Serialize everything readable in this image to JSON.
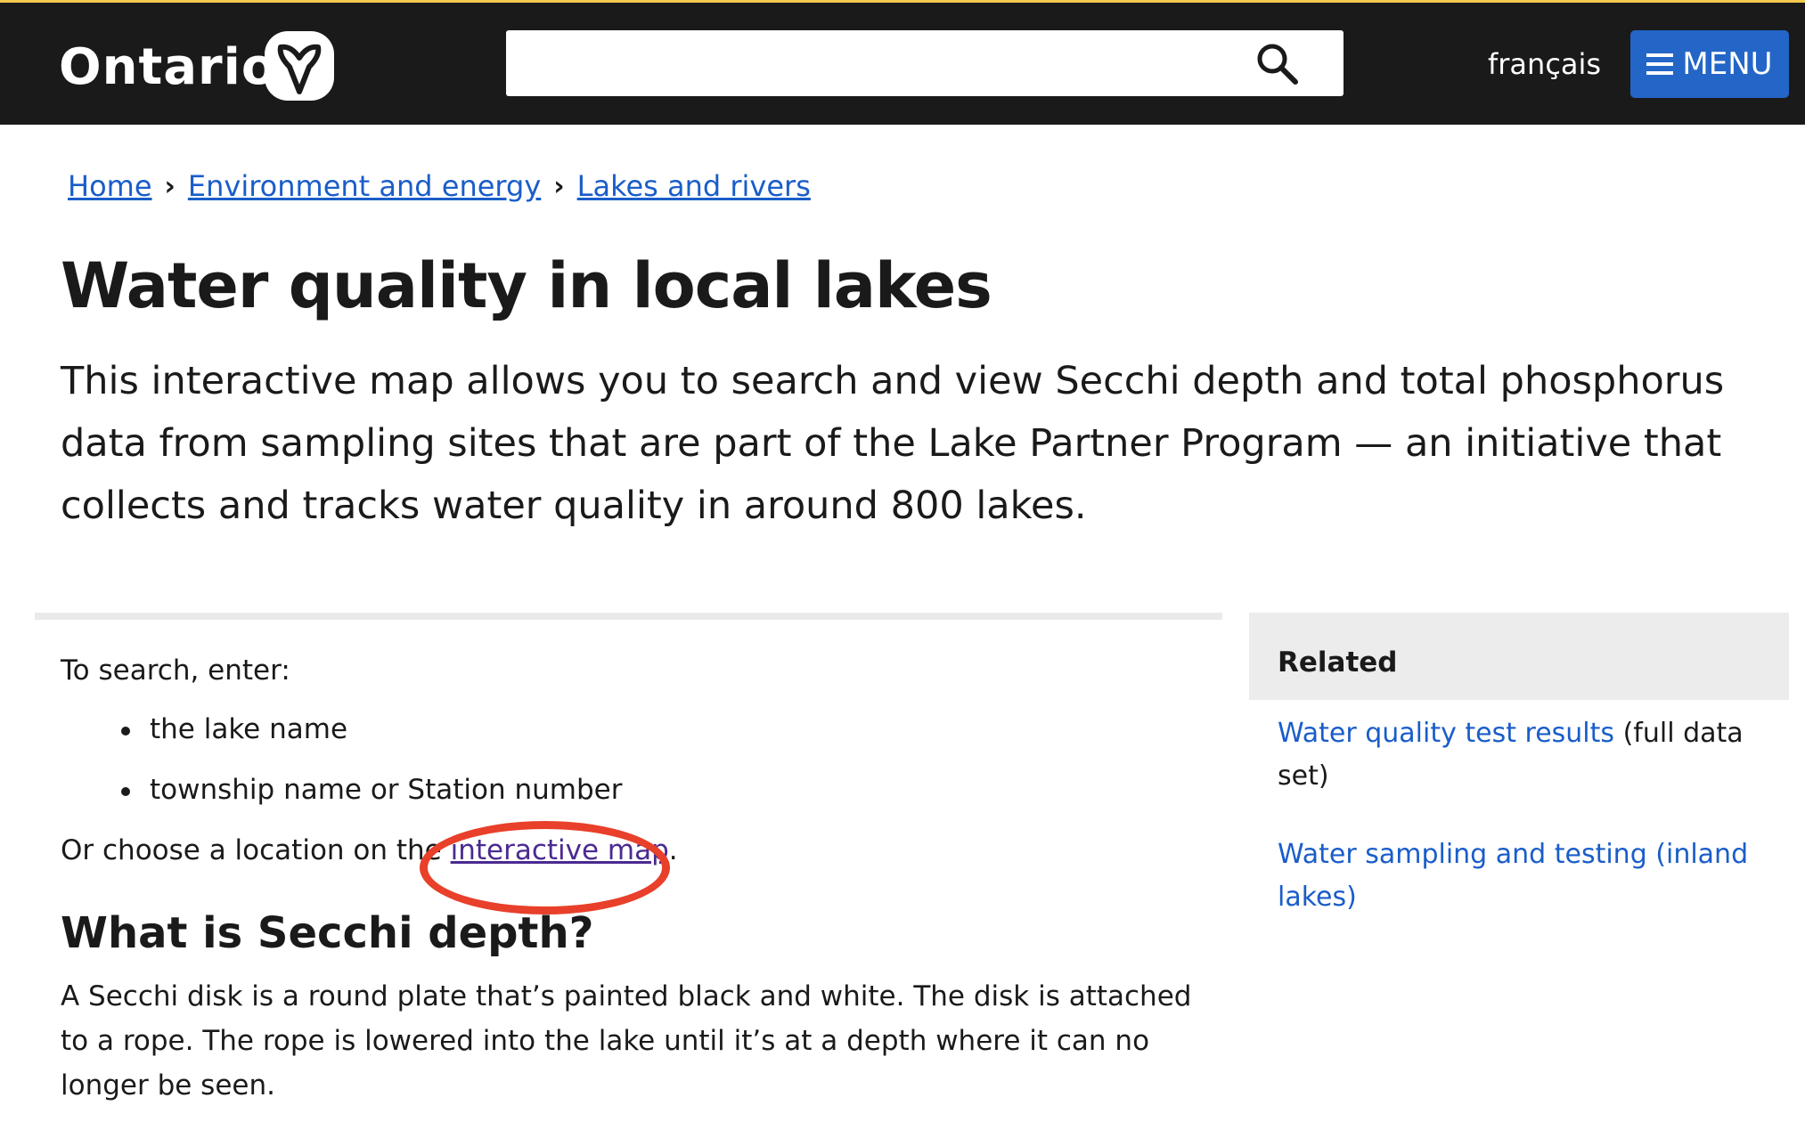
{
  "header": {
    "logo": "Ontario",
    "search_placeholder": "",
    "language": "français",
    "menu_label": "MENU"
  },
  "breadcrumb": [
    "Home",
    "Environment and energy",
    "Lakes and rivers"
  ],
  "title": "Water quality in local lakes",
  "lead": "This interactive map allows you to search and view Secchi depth and total phosphorus data from sampling sites that are part of the Lake Partner Program — an initiative that collects and tracks water quality in around 800 lakes.",
  "main": {
    "search_intro": "To search, enter:",
    "bullets": [
      "the lake name",
      "township name or Station number"
    ],
    "choose_prefix": "Or choose a location on the ",
    "map_link": "interactive map",
    "choose_suffix": ".",
    "h2": "What is Secchi depth?",
    "paragraph": "A Secchi disk is a round plate that’s painted black and white. The disk is attached to a rope. The rope is lowered into the lake until it’s at a depth where it can no longer be seen."
  },
  "related": {
    "heading": "Related",
    "links": [
      {
        "label": "Water quality test results",
        "suffix": " (full data set)"
      },
      {
        "label": "Water sampling and testing (inland lakes)",
        "suffix": ""
      }
    ]
  },
  "colors": {
    "header": "#1a1a1a",
    "accent": "#2366c7",
    "link": "#1a5dc9",
    "visited": "#4b2a91",
    "annotation": "#e8402a"
  }
}
